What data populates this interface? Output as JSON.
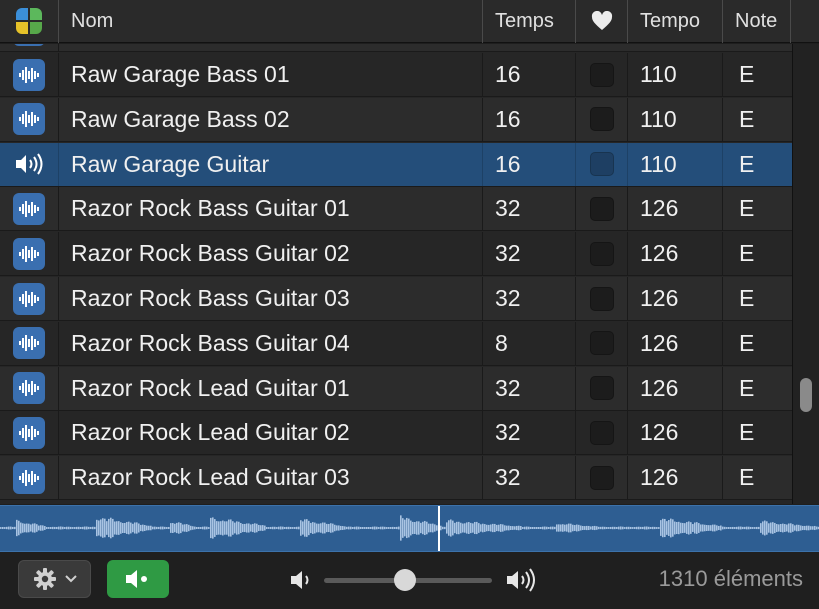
{
  "header": {
    "category_icon": "category-grid-icon",
    "col_name": "Nom",
    "col_beats": "Temps",
    "col_favorite_icon": "heart-icon",
    "col_tempo": "Tempo",
    "col_key": "Note"
  },
  "rows": [
    {
      "name": "Raw Garage Bass 01",
      "beats": "16",
      "tempo": "110",
      "key": "E",
      "icon": "waveform-icon",
      "selected": false
    },
    {
      "name": "Raw Garage Bass 02",
      "beats": "16",
      "tempo": "110",
      "key": "E",
      "icon": "waveform-icon",
      "selected": false
    },
    {
      "name": "Raw Garage Guitar",
      "beats": "16",
      "tempo": "110",
      "key": "E",
      "icon": "speaker-playing-icon",
      "selected": true
    },
    {
      "name": "Razor Rock Bass Guitar 01",
      "beats": "32",
      "tempo": "126",
      "key": "E",
      "icon": "waveform-icon",
      "selected": false
    },
    {
      "name": "Razor Rock Bass Guitar 02",
      "beats": "32",
      "tempo": "126",
      "key": "E",
      "icon": "waveform-icon",
      "selected": false
    },
    {
      "name": "Razor Rock Bass Guitar 03",
      "beats": "32",
      "tempo": "126",
      "key": "E",
      "icon": "waveform-icon",
      "selected": false
    },
    {
      "name": "Razor Rock Bass Guitar 04",
      "beats": "8",
      "tempo": "126",
      "key": "E",
      "icon": "waveform-icon",
      "selected": false
    },
    {
      "name": "Razor Rock Lead Guitar 01",
      "beats": "32",
      "tempo": "126",
      "key": "E",
      "icon": "waveform-icon",
      "selected": false
    },
    {
      "name": "Razor Rock Lead Guitar 02",
      "beats": "32",
      "tempo": "126",
      "key": "E",
      "icon": "waveform-icon",
      "selected": false
    },
    {
      "name": "Razor Rock Lead Guitar 03",
      "beats": "32",
      "tempo": "126",
      "key": "E",
      "icon": "waveform-icon",
      "selected": false
    }
  ],
  "footer": {
    "settings_icon": "gear-icon",
    "preview_icon": "speaker-icon",
    "volume": 0.48,
    "item_count": "1310 éléments"
  },
  "playback_position": 0.535,
  "colors": {
    "selected_row": "#244e7a",
    "waveform_bg": "#2e5e92",
    "accent_green": "#2f9a44",
    "icon_blue": "#3a6fb0"
  }
}
